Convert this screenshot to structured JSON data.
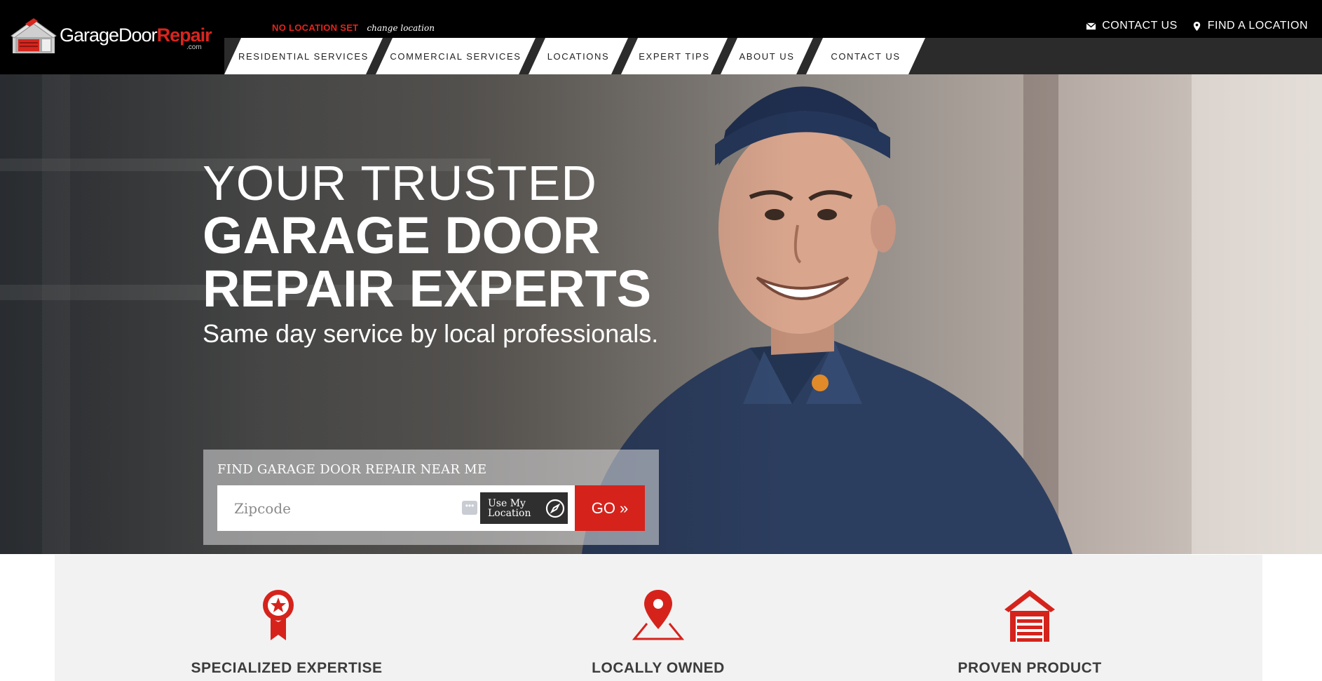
{
  "brand": {
    "logo_text_1": "GarageDoor",
    "logo_text_2": "Repair",
    "logo_suffix": ".com"
  },
  "location": {
    "status": "NO LOCATION SET",
    "change_link": "change location"
  },
  "utility_nav": [
    {
      "label": "CONTACT US",
      "icon": "envelope-icon"
    },
    {
      "label": "FIND A LOCATION",
      "icon": "map-pin-icon"
    }
  ],
  "main_nav": [
    {
      "label": "RESIDENTIAL SERVICES"
    },
    {
      "label": "COMMERCIAL SERVICES"
    },
    {
      "label": "LOCATIONS"
    },
    {
      "label": "EXPERT TIPS"
    },
    {
      "label": "ABOUT US"
    },
    {
      "label": "CONTACT US"
    }
  ],
  "hero": {
    "headline_light": "YOUR TRUSTED",
    "headline_bold_1": "GARAGE DOOR",
    "headline_bold_2": "REPAIR EXPERTS",
    "subheading": "Same day service by local professionals."
  },
  "finder": {
    "title": "FIND GARAGE DOOR REPAIR NEAR ME",
    "zip_placeholder": "Zipcode",
    "use_location_label_1": "Use My",
    "use_location_label_2": "Location",
    "go_label": "GO »"
  },
  "features": [
    {
      "title": "SPECIALIZED EXPERTISE",
      "icon": "award-ribbon-icon"
    },
    {
      "title": "LOCALLY OWNED",
      "icon": "map-marker-icon"
    },
    {
      "title": "PROVEN PRODUCT",
      "icon": "garage-icon"
    }
  ],
  "colors": {
    "brand_red": "#d5231c",
    "header_black": "#000000",
    "nav_strip": "#2b2b2b"
  }
}
